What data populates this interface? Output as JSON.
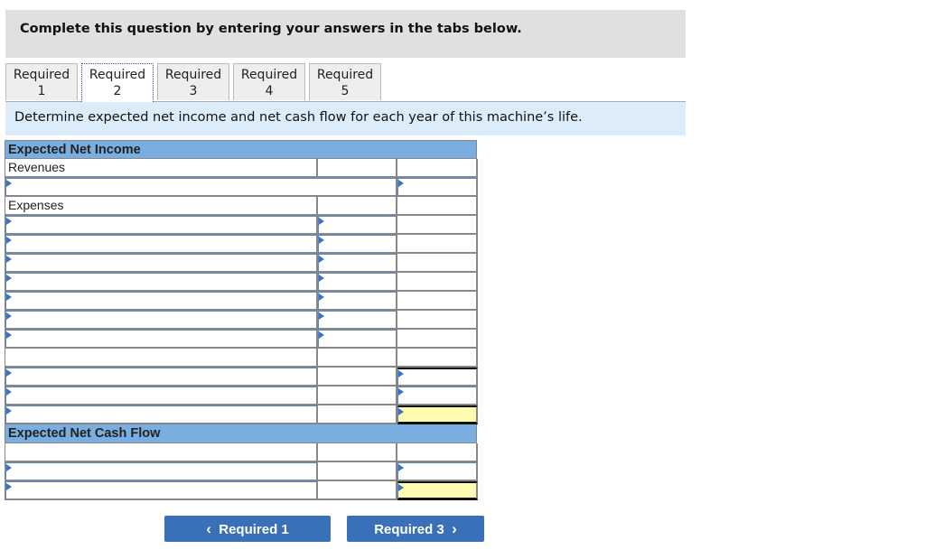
{
  "instruction": "Complete this question by entering your answers in the tabs below.",
  "tabs": [
    {
      "line1": "Required",
      "line2": "1",
      "active": false
    },
    {
      "line1": "Required",
      "line2": "2",
      "active": true
    },
    {
      "line1": "Required",
      "line2": "3",
      "active": false
    },
    {
      "line1": "Required",
      "line2": "4",
      "active": false
    },
    {
      "line1": "Required",
      "line2": "5",
      "active": false
    }
  ],
  "description": "Determine expected net income and net cash flow for each year of this machine’s life.",
  "net_income": {
    "header": "Expected Net Income",
    "revenues_label": "Revenues",
    "expenses_label": "Expenses"
  },
  "cash_flow": {
    "header": "Expected Net Cash Flow"
  },
  "nav": {
    "prev_label": "Required 1",
    "next_label": "Required 3",
    "prev_icon": "chevron-left-icon",
    "next_icon": "chevron-right-icon"
  }
}
